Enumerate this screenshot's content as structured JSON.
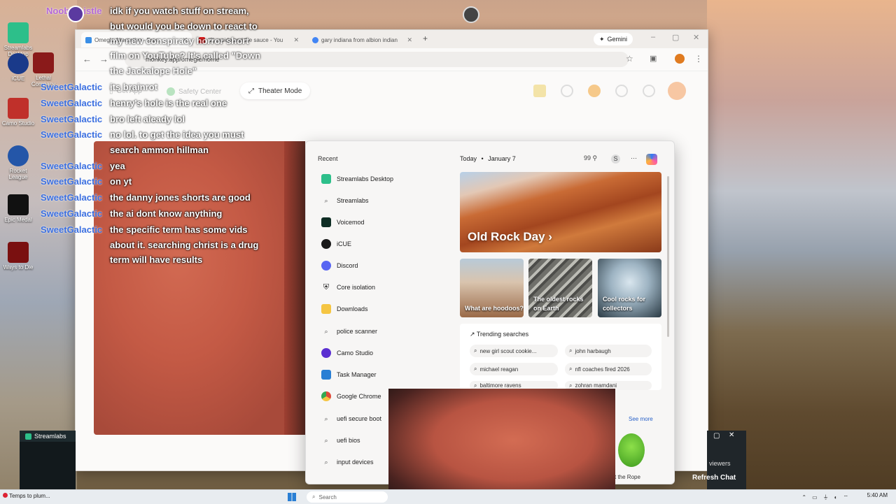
{
  "browser": {
    "tabs": [
      {
        "title": "Omegle Alternative - Free",
        "active": true
      },
      {
        "title": "(2) rapido and the sauce - You"
      },
      {
        "title": "gary indiana from albion indian"
      }
    ],
    "new_tab": "+",
    "gemini_label": "Gemini",
    "url": "monkey.app/omegle/home"
  },
  "site": {
    "get_app": "Get App",
    "safety_center": "Safety Center",
    "theater_mode": "Theater Mode"
  },
  "chat": {
    "top_user": "NoobWhistle",
    "lines": [
      "idk if you watch stuff on stream,",
      "but would you be down to react to",
      "my new conspiracy horror short",
      "film on YouTube? It's called \"Down",
      "the Jackalope Hole\"",
      "its brainrot",
      "henry's hole is the real one",
      "bro left aleady lol",
      "no lol. to get the idea you must",
      "search ammon hillman",
      "yea",
      "on yt",
      "the danny jones shorts are good",
      "the ai dont know anything",
      "the specific term has some vids",
      "about it. searching christ is a drug",
      "term will have results"
    ],
    "username": "SweetGalactic"
  },
  "start_menu": {
    "recent_title": "Recent",
    "recent_items": [
      {
        "label": "Streamlabs Desktop",
        "icon": "streamlabs-icon",
        "color": "#2dbf8a"
      },
      {
        "label": "Streamlabs",
        "icon": "search-icon",
        "color": "#ffffff"
      },
      {
        "label": "Voicemod",
        "icon": "voicemod-icon",
        "color": "#0f2d24"
      },
      {
        "label": "iCUE",
        "icon": "icue-icon",
        "color": "#1a1a1a"
      },
      {
        "label": "Discord",
        "icon": "discord-icon",
        "color": "#5865f2"
      },
      {
        "label": "Core isolation",
        "icon": "shield-icon",
        "color": "#222222"
      },
      {
        "label": "Downloads",
        "icon": "folder-icon",
        "color": "#f5c542"
      },
      {
        "label": "police scanner",
        "icon": "search-icon",
        "color": "#ffffff"
      },
      {
        "label": "Camo Studio",
        "icon": "camo-icon",
        "color": "#5b2fd1"
      },
      {
        "label": "Task Manager",
        "icon": "task-manager-icon",
        "color": "#2a7fd4"
      },
      {
        "label": "Google Chrome",
        "icon": "chrome-icon",
        "color": "#e04a3a"
      },
      {
        "label": "uefi secure boot",
        "icon": "search-icon",
        "color": "#ffffff"
      },
      {
        "label": "uefi bios",
        "icon": "search-icon",
        "color": "#ffffff"
      },
      {
        "label": "input devices",
        "icon": "search-icon",
        "color": "#ffffff"
      }
    ],
    "today_label": "Today",
    "bullet": "•",
    "date": "January 7",
    "points": "99",
    "profile_initial": "S",
    "more": "⋯",
    "hero_title": "Old Rock Day",
    "hero_chevron": "›",
    "cards": [
      {
        "title": "What are hoodoos?"
      },
      {
        "title": "The oldest rocks on Earth"
      },
      {
        "title": "Cool rocks for collectors"
      }
    ],
    "trending_title": "Trending searches",
    "trending": [
      "new girl scout cookie...",
      "john harbaugh",
      "michael reagan",
      "nfl coaches fired 2026",
      "baltimore ravens",
      "zohran mamdani"
    ],
    "see_more": "See more",
    "game_caption": "t the Rope"
  },
  "taskbar": {
    "weather": "Temps to plum...",
    "search_placeholder": "Search",
    "time": "5:40 AM"
  },
  "streamlabs": {
    "title": "Streamlabs"
  },
  "stream_chat": {
    "viewers": "viewers",
    "refresh": "Refresh Chat"
  },
  "desktop_icons": [
    {
      "label": "Streamlabs Desktop"
    },
    {
      "label": "iCUE"
    },
    {
      "label": "Camo Studio"
    },
    {
      "label": "Lethal Company"
    },
    {
      "label": "Rocket League"
    },
    {
      "label": "Epic Medal"
    },
    {
      "label": "Ways to Die"
    }
  ]
}
